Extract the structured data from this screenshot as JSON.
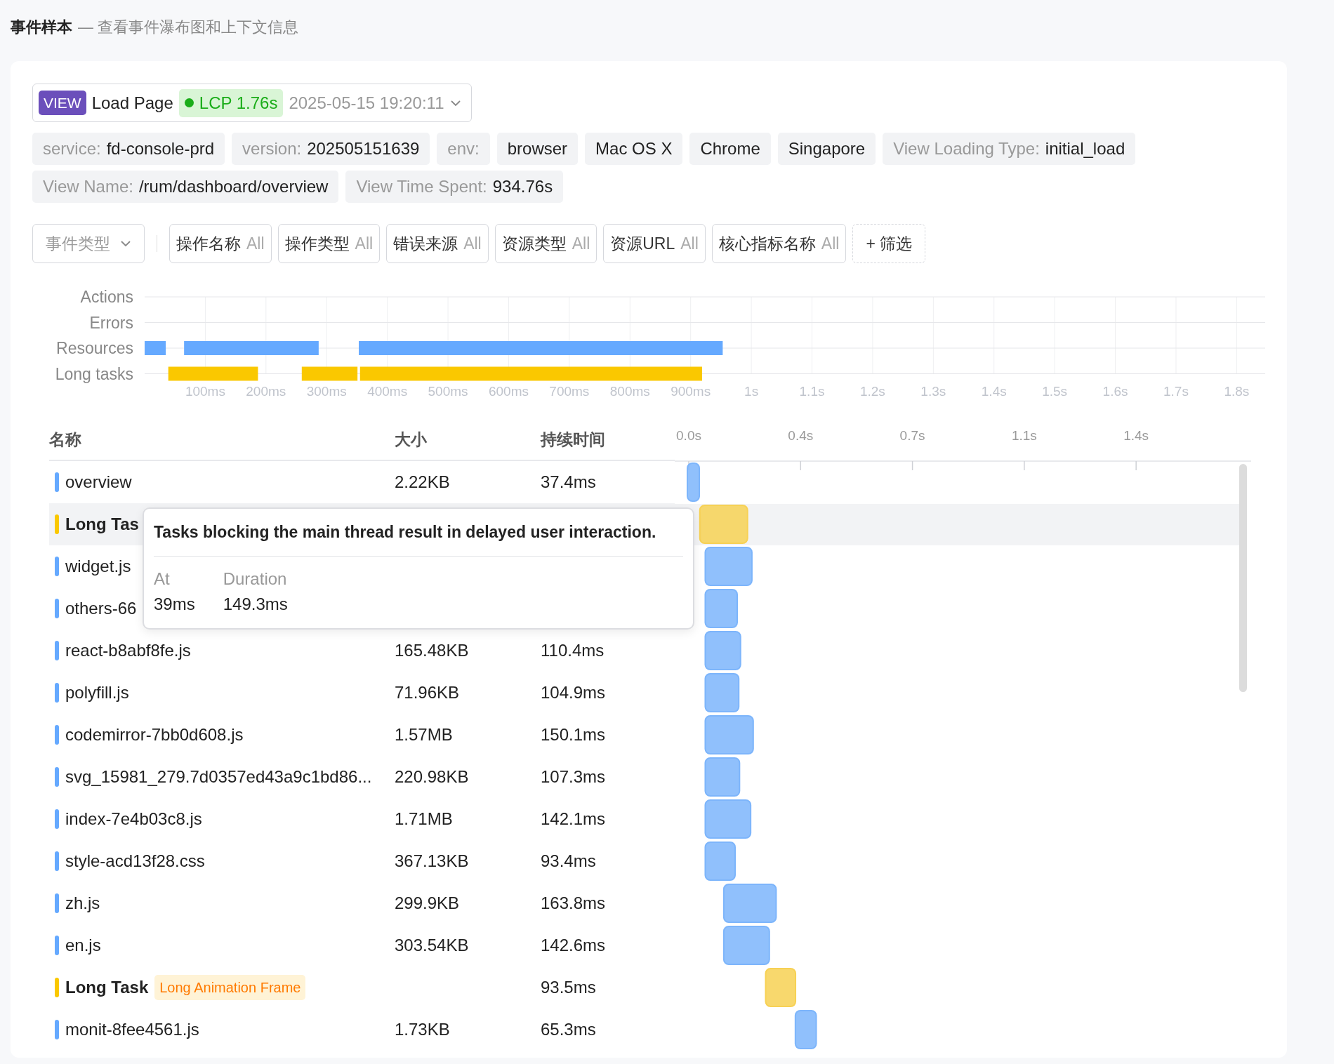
{
  "page": {
    "title": "事件样本",
    "subtitle": "— 查看事件瀑布图和上下文信息"
  },
  "view_select": {
    "type_badge": "VIEW",
    "name": "Load Page",
    "metric": "LCP 1.76s",
    "timestamp": "2025-05-15 19:20:11"
  },
  "tags": [
    {
      "key": "service:",
      "value": "fd-console-prd"
    },
    {
      "key": "version:",
      "value": "202505151639"
    },
    {
      "key": "env:"
    },
    {
      "value": "browser"
    },
    {
      "value": "Mac OS X"
    },
    {
      "value": "Chrome"
    },
    {
      "value": "Singapore"
    },
    {
      "key": "View Loading Type:",
      "value": "initial_load"
    },
    {
      "key": "View Name:",
      "value": "/rum/dashboard/overview"
    },
    {
      "key": "View Time Spent:",
      "value": "934.76s"
    }
  ],
  "filters": {
    "event_type": "事件类型",
    "items": [
      {
        "label": "操作名称",
        "value": "All"
      },
      {
        "label": "操作类型",
        "value": "All"
      },
      {
        "label": "错误来源",
        "value": "All"
      },
      {
        "label": "资源类型",
        "value": "All"
      },
      {
        "label": "资源URL",
        "value": "All"
      },
      {
        "label": "核心指标名称",
        "value": "All"
      }
    ],
    "add": "+ 筛选"
  },
  "overview_timeline": {
    "lanes": [
      "Actions",
      "Errors",
      "Resources",
      "Long tasks"
    ],
    "axis_labels": [
      "100ms",
      "200ms",
      "300ms",
      "400ms",
      "500ms",
      "600ms",
      "700ms",
      "800ms",
      "900ms",
      "1s",
      "1.1s",
      "1.2s",
      "1.3s",
      "1.4s",
      "1.5s",
      "1.6s",
      "1.7s",
      "1.8s"
    ]
  },
  "table": {
    "columns": [
      "名称",
      "大小",
      "持续时间"
    ],
    "rows": [
      {
        "kind": "resource",
        "name": "overview",
        "size": "2.22KB",
        "duration": "37.4ms",
        "hovered": false
      },
      {
        "kind": "long_task",
        "name": "Long Tas",
        "hovered": true
      },
      {
        "kind": "resource",
        "name": "widget.js",
        "hovered": false
      },
      {
        "kind": "resource",
        "name": "others-66",
        "hovered": false
      },
      {
        "kind": "resource",
        "name": "react-b8abf8fe.js",
        "size": "165.48KB",
        "duration": "110.4ms",
        "hovered": false
      },
      {
        "kind": "resource",
        "name": "polyfill.js",
        "size": "71.96KB",
        "duration": "104.9ms",
        "hovered": false
      },
      {
        "kind": "resource",
        "name": "codemirror-7bb0d608.js",
        "size": "1.57MB",
        "duration": "150.1ms",
        "hovered": false
      },
      {
        "kind": "resource",
        "name": "svg_15981_279.7d0357ed43a9c1bd86...",
        "size": "220.98KB",
        "duration": "107.3ms",
        "hovered": false
      },
      {
        "kind": "resource",
        "name": "index-7e4b03c8.js",
        "size": "1.71MB",
        "duration": "142.1ms",
        "hovered": false
      },
      {
        "kind": "resource",
        "name": "style-acd13f28.css",
        "size": "367.13KB",
        "duration": "93.4ms",
        "hovered": false
      },
      {
        "kind": "resource",
        "name": "zh.js",
        "size": "299.9KB",
        "duration": "163.8ms",
        "hovered": false
      },
      {
        "kind": "resource",
        "name": "en.js",
        "size": "303.54KB",
        "duration": "142.6ms",
        "hovered": false
      },
      {
        "kind": "long_task",
        "name": "Long Task",
        "badge": "Long Animation Frame",
        "duration": "93.5ms",
        "hovered": false
      },
      {
        "kind": "resource",
        "name": "monit-8fee4561.js",
        "size": "1.73KB",
        "duration": "65.3ms",
        "hovered": false
      }
    ],
    "tooltip": {
      "title": "Tasks blocking the main thread result in delayed user interaction.",
      "fields": [
        {
          "label": "At",
          "value": "39ms"
        },
        {
          "label": "Duration",
          "value": "149.3ms"
        }
      ]
    },
    "waterfall": {
      "axis_labels": [
        "0.0s",
        "0.4s",
        "0.7s",
        "1.1s",
        "1.4s"
      ]
    }
  }
}
